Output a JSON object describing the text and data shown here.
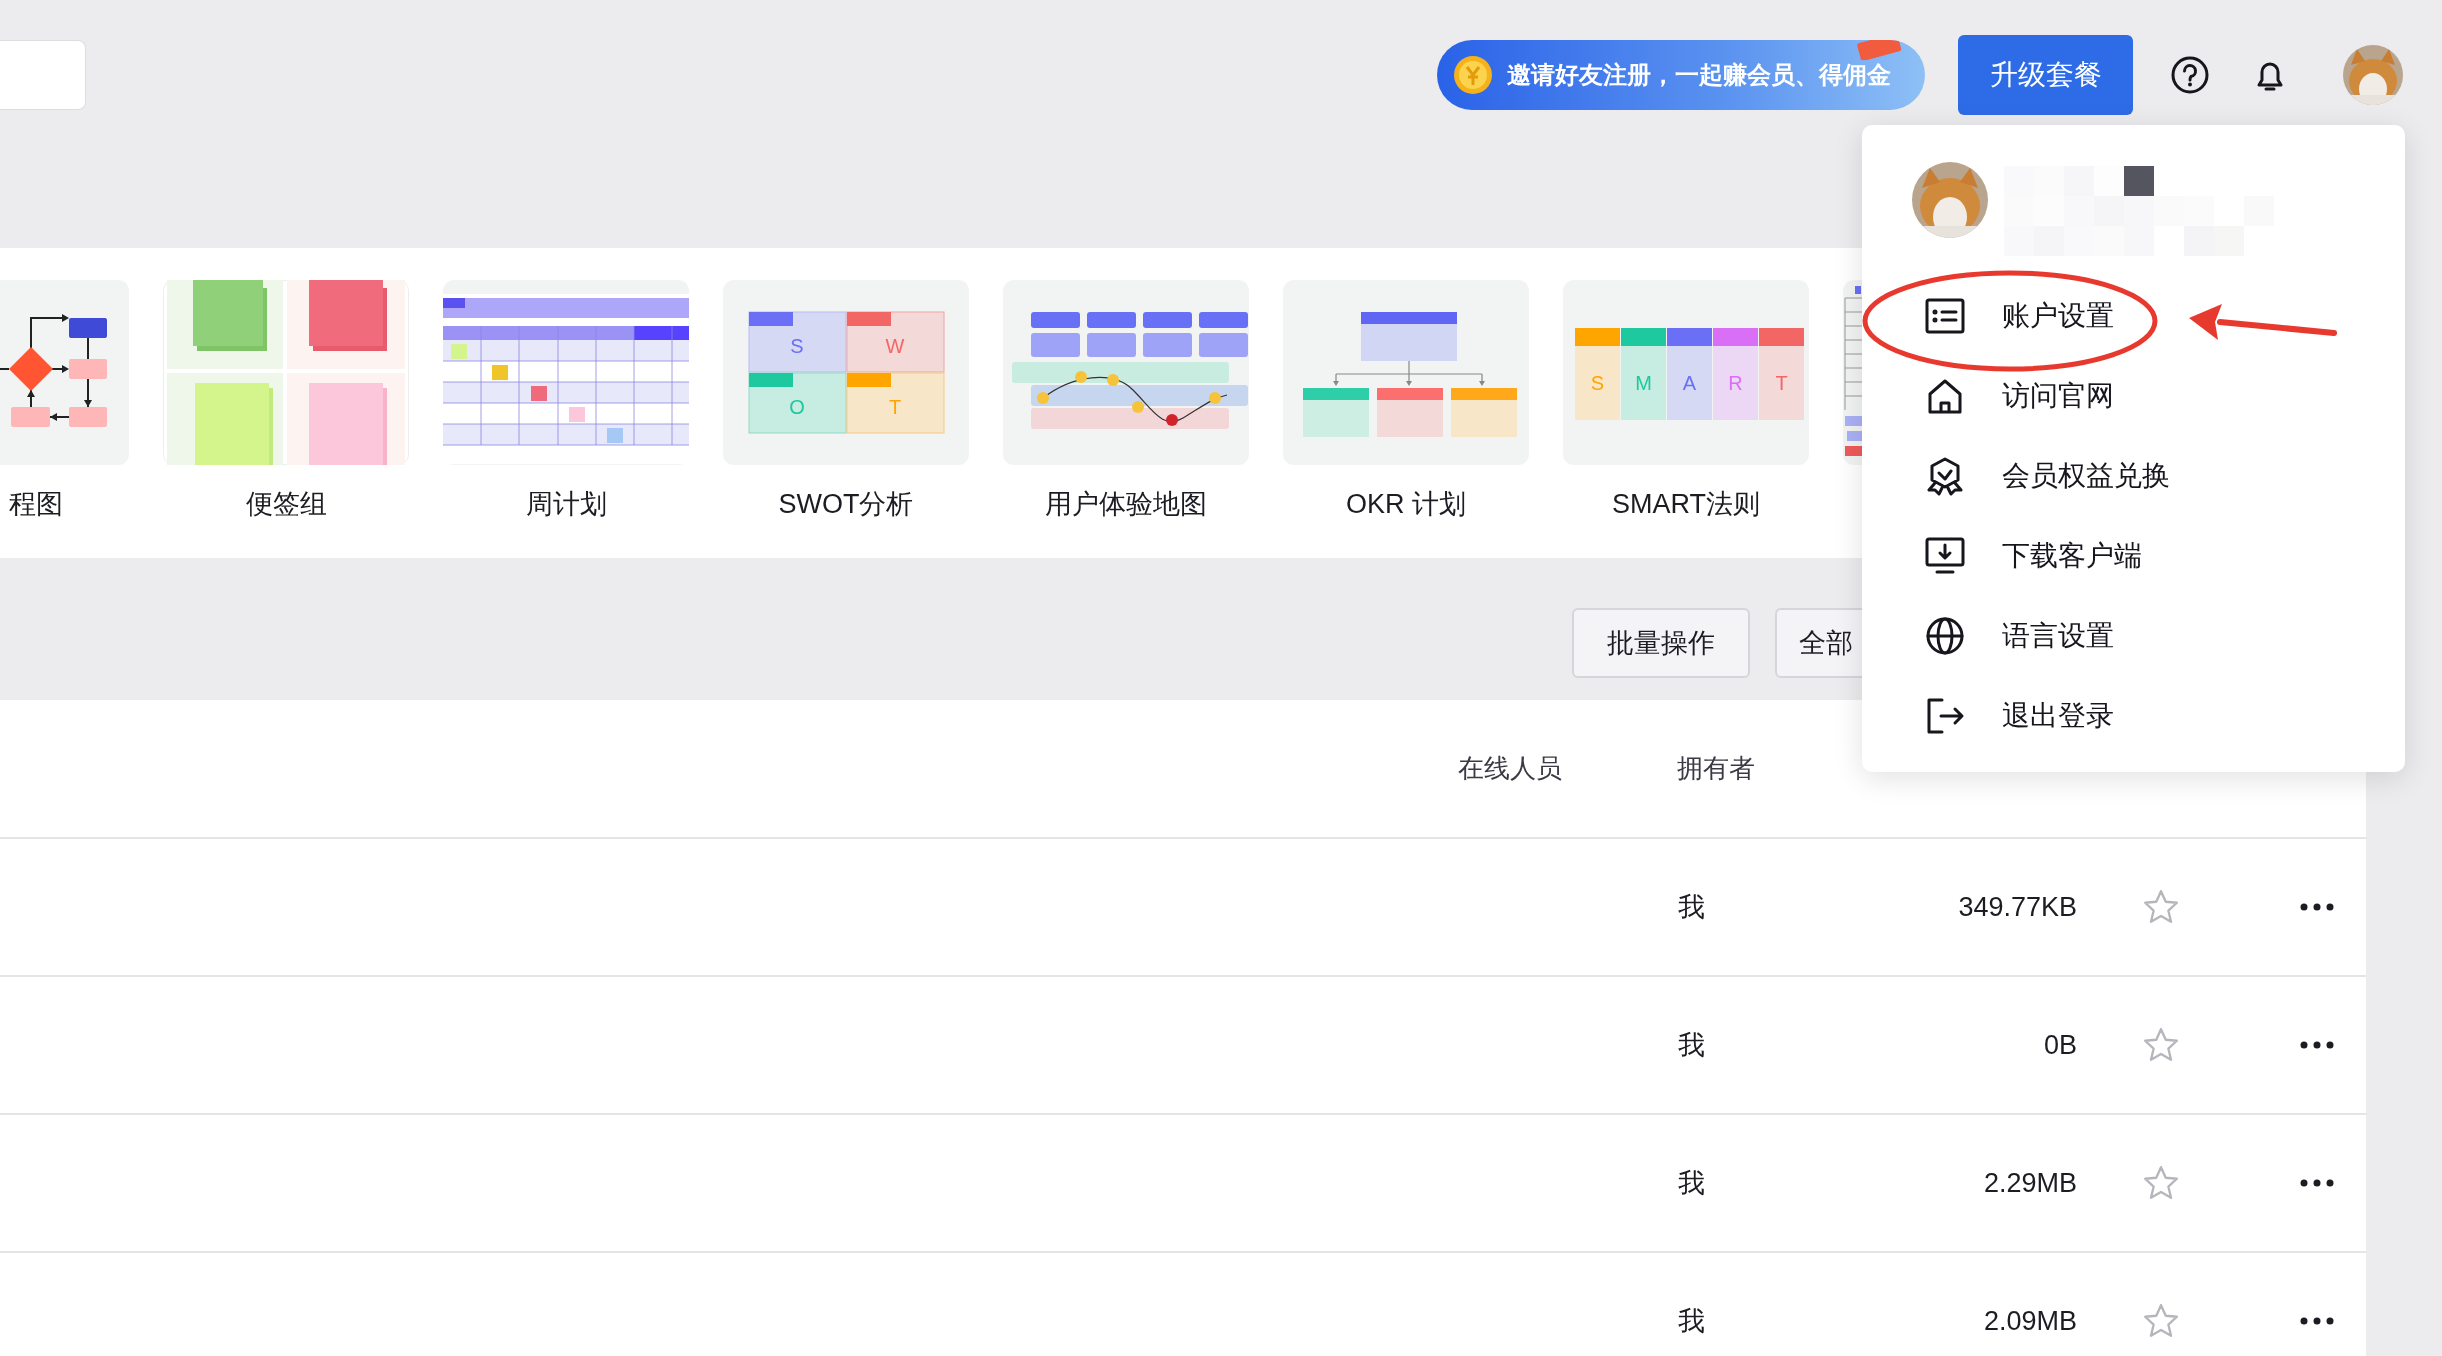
{
  "topbar": {
    "invite_banner": "邀请好友注册，一起赚会员、得佣金",
    "upgrade_button": "升级套餐"
  },
  "templates": [
    {
      "label": "程图",
      "kind": "flowchart"
    },
    {
      "label": "便签组",
      "kind": "sticky"
    },
    {
      "label": "周计划",
      "kind": "weekly"
    },
    {
      "label": "SWOT分析",
      "kind": "swot",
      "letters": [
        "S",
        "W",
        "O",
        "T"
      ]
    },
    {
      "label": "用户体验地图",
      "kind": "journey"
    },
    {
      "label": "OKR 计划",
      "kind": "okr"
    },
    {
      "label": "SMART法则",
      "kind": "smart",
      "letters": [
        "S",
        "M",
        "A",
        "R",
        "T"
      ]
    },
    {
      "kind": "grid"
    }
  ],
  "toolbar": {
    "buttons": [
      "批量操作",
      "全部"
    ]
  },
  "table": {
    "columns": [
      "在线人员",
      "拥有者"
    ],
    "rows": [
      {
        "owner": "我",
        "size": "349.77KB",
        "starred": false
      },
      {
        "owner": "我",
        "size": "0B",
        "starred": false
      },
      {
        "owner": "我",
        "size": "2.29MB",
        "starred": false
      },
      {
        "owner": "我",
        "size": "2.09MB",
        "starred": false
      }
    ]
  },
  "user_menu": {
    "items": [
      {
        "label": "账户设置",
        "kind": "account"
      },
      {
        "label": "访问官网",
        "kind": "home"
      },
      {
        "label": "会员权益兑换",
        "kind": "badge"
      },
      {
        "label": "下载客户端",
        "kind": "download"
      },
      {
        "label": "语言设置",
        "kind": "language"
      },
      {
        "label": "退出登录",
        "kind": "logout"
      }
    ]
  }
}
